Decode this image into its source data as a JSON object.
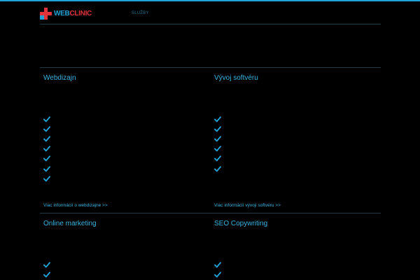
{
  "brand": {
    "logo_web": "WEB",
    "logo_clinic": "CLINIC",
    "accent_blue": "#1fa3d6",
    "accent_red": "#e0333c"
  },
  "nav": {
    "services_label": "SLUŽBY"
  },
  "services": [
    {
      "title": "Webdizajn",
      "check_count": 7,
      "link": "Viac informácií o webdizajne >>"
    },
    {
      "title": "Vývoj softvéru",
      "check_count": 6,
      "link": "Viac informácií vývoji softvéru >>"
    },
    {
      "title": "Online marketing",
      "check_count": 2,
      "link": ""
    },
    {
      "title": "SEO Copywriting",
      "check_count": 2,
      "link": ""
    }
  ],
  "icons": {
    "check": "checkmark-icon"
  }
}
